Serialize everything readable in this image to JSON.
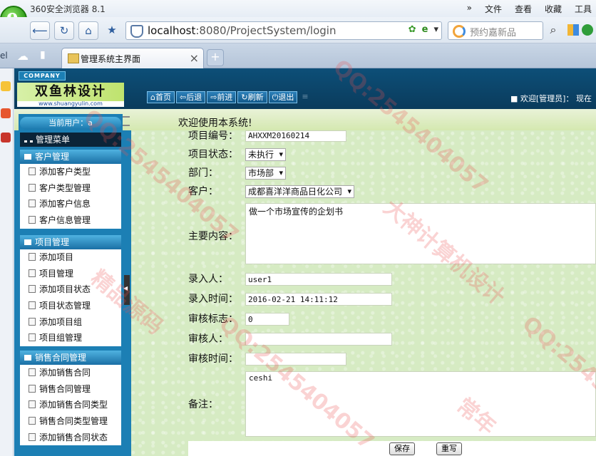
{
  "browser": {
    "app_title": "360安全浏览器 8.1",
    "menu": [
      "»",
      "文件",
      "查看",
      "收藏",
      "工具"
    ],
    "url_host": "localhost",
    "url_rest": ":8080/ProjectSystem/login",
    "search_placeholder": "预约嘉新品",
    "tab_title": "管理系统主界面",
    "newtab_symbol": "+",
    "left_label": "el"
  },
  "site": {
    "company": "COMPANY",
    "logo_text": "双鱼林设计",
    "logo_url": "www.shuangyulin.com",
    "nav_buttons": [
      "首页",
      "后退",
      "前进",
      "刷新",
      "退出"
    ],
    "welcome_user": "欢迎[管理员]：  现在",
    "welcome_message": "欢迎使用本系统!"
  },
  "menu": {
    "current_user": "当前用户：a",
    "root": "管理菜单",
    "groups": [
      {
        "title": "客户管理",
        "items": [
          "添加客户类型",
          "客户类型管理",
          "添加客户信息",
          "客户信息管理"
        ]
      },
      {
        "title": "项目管理",
        "items": [
          "添加项目",
          "项目管理",
          "添加项目状态",
          "项目状态管理",
          "添加项目组",
          "项目组管理"
        ]
      },
      {
        "title": "销售合同管理",
        "items": [
          "添加销售合同",
          "销售合同管理",
          "添加销售合同类型",
          "销售合同类型管理",
          "添加销售合同状态"
        ]
      }
    ]
  },
  "form": {
    "project_no_label": "项目编号：",
    "project_no": "AHXXM20160214",
    "status_label": "项目状态：",
    "status": "未执行",
    "dept_label": "部门：",
    "dept": "市场部",
    "customer_label": "客户：",
    "customer": "成都喜洋洋商品日化公司",
    "content_label": "主要内容：",
    "content": "做一个市场宣传的企划书",
    "entry_user_label": "录入人：",
    "entry_user": "user1",
    "entry_time_label": "录入时间：",
    "entry_time": "2016-02-21 14:11:12",
    "audit_flag_label": "审核标志：",
    "audit_flag": "0",
    "auditor_label": "审核人：",
    "auditor": "",
    "audit_time_label": "审核时间：",
    "audit_time": "",
    "remark_label": "备注：",
    "remark": "ceshi",
    "save_label": "保存",
    "reset_label": "重写"
  },
  "watermarks": [
    "QQ:2545404057",
    "大神计算机设计",
    "精品源码",
    "常年",
    "QQ:2545"
  ]
}
